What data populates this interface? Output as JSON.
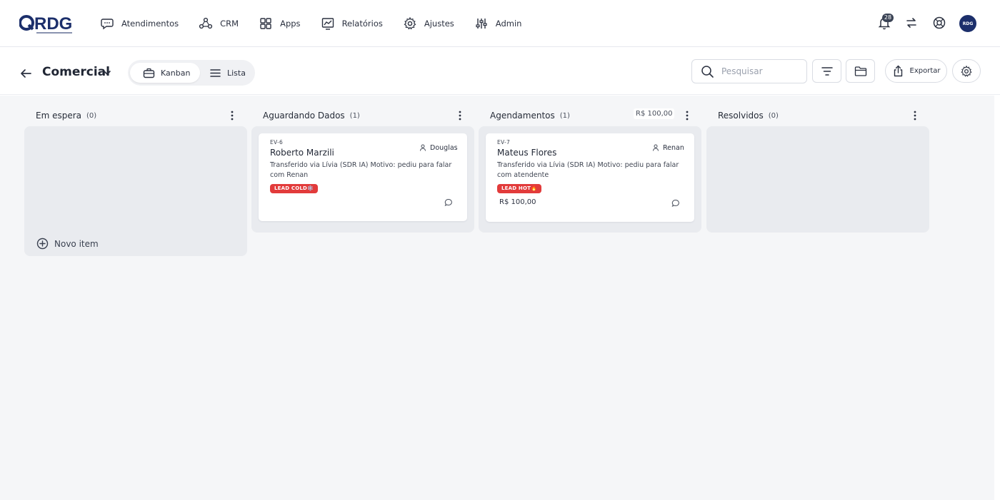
{
  "brand": {
    "logo_text": "RDG",
    "accent": "#1c2f6b"
  },
  "nav": {
    "items": [
      {
        "label": "Atendimentos",
        "icon": "chat-bubble-icon"
      },
      {
        "label": "CRM",
        "icon": "crm-nodes-icon"
      },
      {
        "label": "Apps",
        "icon": "apps-grid-icon"
      },
      {
        "label": "Relatórios",
        "icon": "chart-icon"
      },
      {
        "label": "Ajustes",
        "icon": "gear-icon"
      },
      {
        "label": "Admin",
        "icon": "admin-icon"
      }
    ],
    "notifications_count": "28",
    "avatar_text": "RDG"
  },
  "board": {
    "title": "Comercial",
    "views": {
      "kanban": "Kanban",
      "lista": "Lista",
      "active": "Kanban"
    },
    "search": {
      "placeholder": "Pesquisar",
      "value": ""
    },
    "export_label": "Exportar"
  },
  "columns": [
    {
      "title": "Em espera",
      "count": "(0)",
      "total": "",
      "novo_item": "Novo item"
    },
    {
      "title": "Aguardando Dados",
      "count": "(1)",
      "total": ""
    },
    {
      "title": "Agendamentos",
      "count": "(1)",
      "total": "R$ 100,00"
    },
    {
      "title": "Resolvidos",
      "count": "(0)",
      "total": ""
    }
  ],
  "cards": [
    {
      "id": "EV-6",
      "name": "Roberto Marzili",
      "owner": "Douglas",
      "description": "Transferido via Lívia (SDR IA) Motivo: pediu para falar com Renan",
      "tag": "LEAD COLD❄️",
      "value": ""
    },
    {
      "id": "EV-7",
      "name": "Mateus Flores",
      "owner": "Renan",
      "description": "Transferido via Lívia (SDR IA) Motivo: pediu para falar com atendente",
      "tag": "LEAD HOT🔥",
      "value": "R$ 100,00"
    }
  ],
  "colors": {
    "tag_red": "#e23b3b",
    "board_bg": "#f5f6f8",
    "column_bg": "#e9ebef"
  }
}
